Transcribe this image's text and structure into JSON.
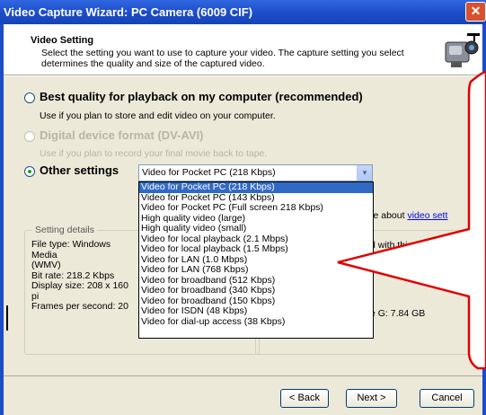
{
  "window": {
    "title": "Video Capture Wizard: PC Camera (6009 CIF)",
    "close_glyph": "✕"
  },
  "header": {
    "title": "Video Setting",
    "description": "Select the setting you want to use to capture your video. The capture setting you select determines the quality and size of the captured video."
  },
  "options": [
    {
      "label": "Best quality for playback on my computer (recommended)",
      "desc": "Use if you plan to store and edit video on your computer.",
      "checked": false,
      "disabled": false
    },
    {
      "label": "Digital device format (DV-AVI)",
      "desc": "Use if you plan to record your final movie back to tape.",
      "checked": false,
      "disabled": true
    },
    {
      "label": "Other settings",
      "desc": "",
      "checked": true,
      "disabled": false
    }
  ],
  "select": {
    "value": "Video for Pocket PC (218 Kbps)",
    "arrow_glyph": "▾"
  },
  "dropdown": [
    "Video for Pocket PC (218 Kbps)",
    "Video for Pocket PC (143 Kbps)",
    "Video for Pocket PC (Full screen 218 Kbps)",
    "High quality video (large)",
    "High quality video (small)",
    "Video for local playback (2.1 Mbps)",
    "Video for local playback (1.5 Mbps)",
    "Video for LAN (1.0 Mbps)",
    "Video for LAN (768 Kbps)",
    "Video for broadband (512 Kbps)",
    "Video for broadband (340 Kbps)",
    "Video for broadband (150 Kbps)",
    "Video for ISDN (48 Kbps)",
    "Video for dial-up access (38 Kbps)"
  ],
  "more_about": {
    "text": "re about ",
    "link": "video sett"
  },
  "setting_details": {
    "title": "Setting details",
    "lines": [
      "File type: Windows Media",
      "(WMV)",
      "Bit rate: 218.2 Kbps",
      "Display size: 208 x 160 pi",
      "Frames per second: 20"
    ]
  },
  "right_panel": {
    "line1": "d with this setti",
    "line2": "e G: 7.84 GB"
  },
  "buttons": {
    "back": "< Back",
    "next": "Next >",
    "cancel": "Cancel"
  }
}
